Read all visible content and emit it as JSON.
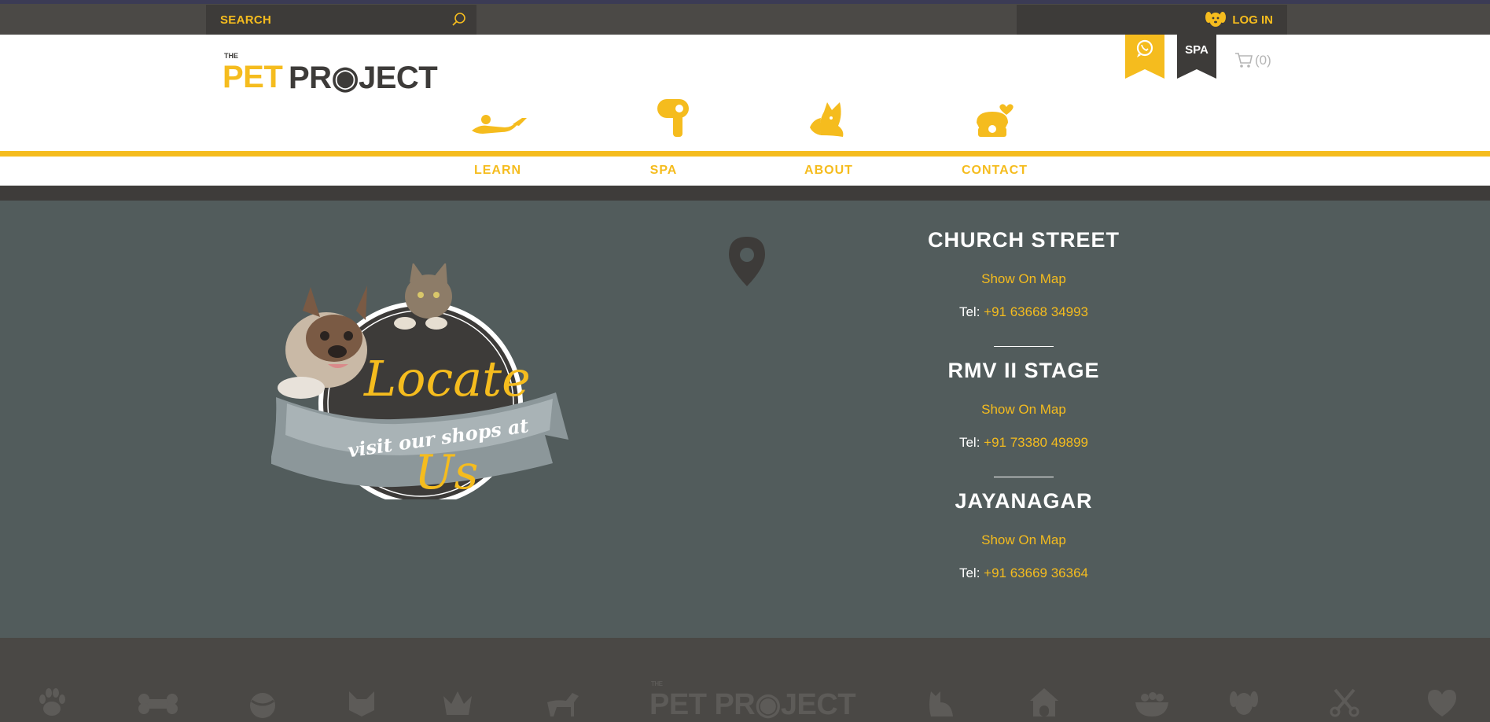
{
  "topbar": {
    "search_placeholder": "SEARCH",
    "login_label": "LOG IN"
  },
  "header": {
    "logo": {
      "the": "THE",
      "pet": "PET",
      "project": "PR◉JECT"
    },
    "spa_tab": "SPA",
    "cart_count": "(0)"
  },
  "nav": {
    "items": [
      {
        "label": "LEARN",
        "icon": "reclining-person-icon"
      },
      {
        "label": "SPA",
        "icon": "hair-dryer-icon"
      },
      {
        "label": "ABOUT",
        "icon": "dog-head-icon"
      },
      {
        "label": "CONTACT",
        "icon": "phone-heart-icon"
      }
    ]
  },
  "locate": {
    "badge_title": "Locate Us",
    "badge_banner": "visit our shops at"
  },
  "stores": [
    {
      "name": "CHURCH STREET",
      "map_link": "Show On Map",
      "tel_label": "Tel:",
      "tel": "+91 63668 34993"
    },
    {
      "name": "RMV II STAGE",
      "map_link": "Show On Map",
      "tel_label": "Tel:",
      "tel": "+91 73380 49899"
    },
    {
      "name": "JAYANAGAR",
      "map_link": "Show On Map",
      "tel_label": "Tel:",
      "tel": "+91 63669 36364"
    }
  ],
  "footer": {
    "logo_the": "THE",
    "logo": "PET PR◉JECT",
    "icons": [
      "paw-icon",
      "bone-icon",
      "ball-icon",
      "cat-face-icon",
      "crown-icon",
      "dog-walking-icon",
      "cat-sitting-icon",
      "dog-house-icon",
      "food-bowl-icon",
      "dog-face-icon",
      "scissors-icon",
      "heart-paw-icon"
    ]
  },
  "colors": {
    "accent": "#f5bc1e",
    "dark": "#3d3b39",
    "locations_bg": "#525c5c",
    "white": "#ffffff"
  }
}
